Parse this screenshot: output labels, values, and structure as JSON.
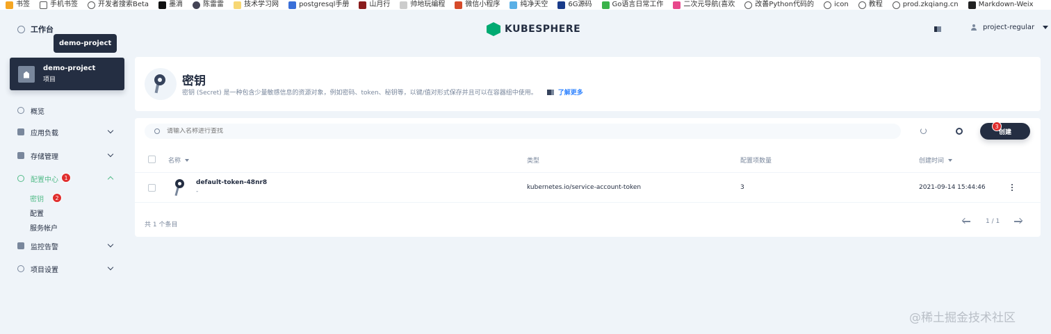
{
  "bookmarks": [
    "书签",
    "手机书签",
    "开发者搜索Beta",
    "墨滴",
    "陈雷雷",
    "技术学习网",
    "postgresql手册",
    "山月行",
    "帅地玩编程",
    "微信小程序",
    "纯净天空",
    "6G源码",
    "Go语言日常工作",
    "二次元导航(喜欢",
    "改善Python代码的",
    "icon",
    "教程",
    "prod.zkqiang.cn",
    "Markdown-Weix"
  ],
  "header": {
    "workbench": "工作台",
    "tooltip": "demo-project",
    "logo": "KUBESPHERE",
    "user": "project-regular"
  },
  "project": {
    "name": "demo-project",
    "type": "项目"
  },
  "nav": {
    "overview": "概览",
    "workloads": "应用负载",
    "storage": "存储管理",
    "config": "配置中心",
    "config_badge": "1",
    "sub_secrets": "密钥",
    "sub_secrets_badge": "2",
    "sub_configmaps": "配置",
    "sub_serviceaccounts": "服务帐户",
    "monitoring": "监控告警",
    "settings": "项目设置"
  },
  "banner": {
    "title": "密钥",
    "desc": "密钥 (Secret) 是一种包含少量敏感信息的资源对象，例如密码、token、秘钥等，以键/值对形式保存并且可以在容器组中使用。",
    "learn_more": "了解更多"
  },
  "toolbar": {
    "search_placeholder": "请输入名称进行查找",
    "create": "创建",
    "create_badge": "3"
  },
  "table": {
    "columns": {
      "name": "名称",
      "type": "类型",
      "count": "配置项数量",
      "created": "创建时间"
    },
    "rows": [
      {
        "name": "default-token-48nr8",
        "sub": "-",
        "type": "kubernetes.io/service-account-token",
        "count": "3",
        "created": "2021-09-14 15:44:46"
      }
    ]
  },
  "footer": {
    "count": "共 1 个条目",
    "page": "1 / 1"
  },
  "watermark": "@稀土掘金技术社区",
  "colors": {
    "accent": "#55bc8a",
    "dark": "#242e42",
    "badge": "#e02e2e",
    "link": "#3385ff"
  }
}
